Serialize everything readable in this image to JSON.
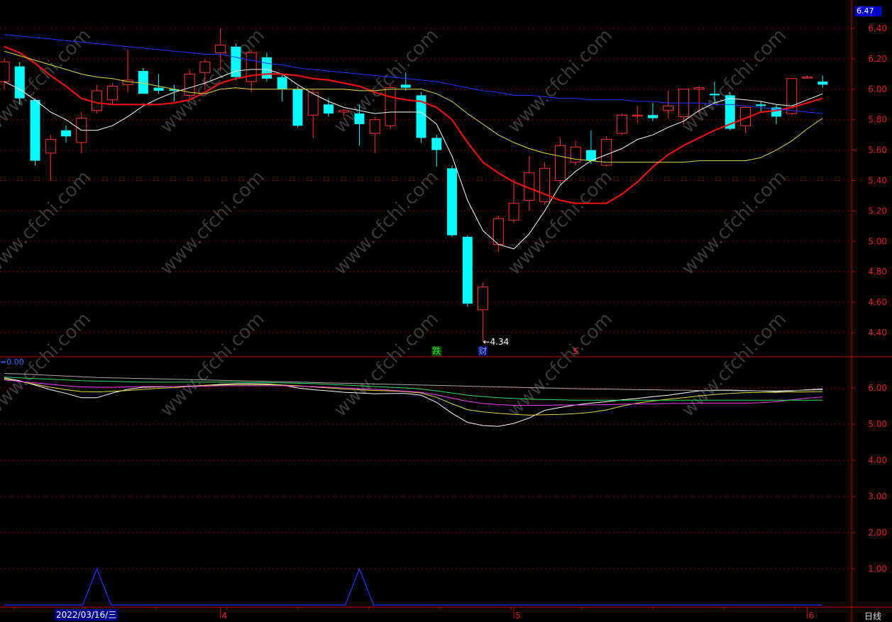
{
  "header": {
    "price_label": "6.47"
  },
  "footer": {
    "date_label": "2022/03/16/三",
    "period_label": "日线"
  },
  "sub_panel": {
    "label": "=0.00"
  },
  "chart_data": [
    {
      "type": "candlestick",
      "panel": "main",
      "y_ticks": [
        "6.40",
        "6.20",
        "6.00",
        "5.80",
        "5.60",
        "5.40",
        "5.20",
        "5.00",
        "4.80",
        "4.60",
        "4.40"
      ],
      "ylim": [
        4.24,
        6.47
      ],
      "x_ticks": [
        {
          "index": 14,
          "label": "4"
        },
        {
          "index": 33,
          "label": "5"
        },
        {
          "index": 52,
          "label": "6"
        }
      ],
      "colors": {
        "up": "#ff3333",
        "down": "#00ffff",
        "grid": "#8a0000",
        "axis": "#cc0000"
      },
      "candles": [
        {
          "o": 6.05,
          "h": 6.2,
          "l": 6.0,
          "c": 6.18
        },
        {
          "o": 6.15,
          "h": 6.18,
          "l": 5.9,
          "c": 5.94
        },
        {
          "o": 5.93,
          "h": 5.94,
          "l": 5.5,
          "c": 5.53
        },
        {
          "o": 5.58,
          "h": 5.7,
          "l": 5.4,
          "c": 5.67
        },
        {
          "o": 5.73,
          "h": 5.76,
          "l": 5.65,
          "c": 5.69
        },
        {
          "o": 5.65,
          "h": 5.85,
          "l": 5.58,
          "c": 5.81
        },
        {
          "o": 5.86,
          "h": 6.03,
          "l": 5.84,
          "c": 5.99
        },
        {
          "o": 5.93,
          "h": 6.04,
          "l": 5.9,
          "c": 6.02
        },
        {
          "o": 6.03,
          "h": 6.26,
          "l": 5.98,
          "c": 6.06
        },
        {
          "o": 6.12,
          "h": 6.14,
          "l": 5.98,
          "c": 5.97
        },
        {
          "o": 6.01,
          "h": 6.1,
          "l": 5.97,
          "c": 5.99
        },
        {
          "o": 6.0,
          "h": 6.03,
          "l": 5.92,
          "c": 5.99
        },
        {
          "o": 5.96,
          "h": 6.13,
          "l": 5.93,
          "c": 6.1
        },
        {
          "o": 6.11,
          "h": 6.2,
          "l": 6.0,
          "c": 6.18
        },
        {
          "o": 6.24,
          "h": 6.4,
          "l": 6.12,
          "c": 6.29
        },
        {
          "o": 6.28,
          "h": 6.3,
          "l": 6.06,
          "c": 6.08
        },
        {
          "o": 6.05,
          "h": 6.26,
          "l": 5.98,
          "c": 6.24
        },
        {
          "o": 6.21,
          "h": 6.24,
          "l": 6.05,
          "c": 6.07
        },
        {
          "o": 6.08,
          "h": 6.1,
          "l": 5.92,
          "c": 6.0
        },
        {
          "o": 6.0,
          "h": 6.02,
          "l": 5.75,
          "c": 5.76
        },
        {
          "o": 5.83,
          "h": 6.0,
          "l": 5.68,
          "c": 5.98
        },
        {
          "o": 5.9,
          "h": 5.94,
          "l": 5.82,
          "c": 5.84
        },
        {
          "o": 5.85,
          "h": 5.87,
          "l": 5.82,
          "c": 5.86
        },
        {
          "o": 5.84,
          "h": 5.9,
          "l": 5.63,
          "c": 5.77
        },
        {
          "o": 5.71,
          "h": 5.82,
          "l": 5.58,
          "c": 5.8
        },
        {
          "o": 5.76,
          "h": 6.03,
          "l": 5.74,
          "c": 6.01
        },
        {
          "o": 6.03,
          "h": 6.11,
          "l": 5.99,
          "c": 6.01
        },
        {
          "o": 5.96,
          "h": 5.98,
          "l": 5.65,
          "c": 5.68
        },
        {
          "o": 5.68,
          "h": 5.7,
          "l": 5.49,
          "c": 5.6
        },
        {
          "o": 5.48,
          "h": 5.5,
          "l": 5.03,
          "c": 5.04
        },
        {
          "o": 5.03,
          "h": 5.04,
          "l": 4.57,
          "c": 4.59
        },
        {
          "o": 4.55,
          "h": 4.73,
          "l": 4.34,
          "c": 4.7
        },
        {
          "o": 4.98,
          "h": 5.17,
          "l": 4.93,
          "c": 5.15
        },
        {
          "o": 5.14,
          "h": 5.41,
          "l": 5.12,
          "c": 5.25
        },
        {
          "o": 5.27,
          "h": 5.56,
          "l": 5.2,
          "c": 5.45
        },
        {
          "o": 5.26,
          "h": 5.52,
          "l": 5.24,
          "c": 5.48
        },
        {
          "o": 5.4,
          "h": 5.68,
          "l": 5.38,
          "c": 5.63
        },
        {
          "o": 5.52,
          "h": 5.66,
          "l": 5.5,
          "c": 5.62
        },
        {
          "o": 5.6,
          "h": 5.73,
          "l": 5.51,
          "c": 5.53
        },
        {
          "o": 5.5,
          "h": 5.69,
          "l": 5.49,
          "c": 5.67
        },
        {
          "o": 5.71,
          "h": 5.84,
          "l": 5.7,
          "c": 5.83
        },
        {
          "o": 5.83,
          "h": 5.89,
          "l": 5.78,
          "c": 5.83
        },
        {
          "o": 5.83,
          "h": 5.91,
          "l": 5.79,
          "c": 5.81
        },
        {
          "o": 5.86,
          "h": 5.99,
          "l": 5.81,
          "c": 5.89
        },
        {
          "o": 5.82,
          "h": 6.0,
          "l": 5.77,
          "c": 6.0
        },
        {
          "o": 6.0,
          "h": 6.02,
          "l": 5.84,
          "c": 6.01
        },
        {
          "o": 5.97,
          "h": 6.05,
          "l": 5.91,
          "c": 5.96
        },
        {
          "o": 5.96,
          "h": 5.98,
          "l": 5.73,
          "c": 5.74
        },
        {
          "o": 5.76,
          "h": 5.89,
          "l": 5.71,
          "c": 5.88
        },
        {
          "o": 5.9,
          "h": 5.92,
          "l": 5.85,
          "c": 5.89
        },
        {
          "o": 5.88,
          "h": 5.9,
          "l": 5.77,
          "c": 5.82
        },
        {
          "o": 5.84,
          "h": 6.07,
          "l": 5.83,
          "c": 6.07
        },
        {
          "o": 6.08,
          "h": 6.09,
          "l": 6.07,
          "c": 6.08
        },
        {
          "o": 6.05,
          "h": 6.09,
          "l": 6.01,
          "c": 6.03
        }
      ],
      "ma_lines": [
        {
          "color": "#ffffff",
          "width": 1,
          "values": [
            6.05,
            6.0,
            5.93,
            5.85,
            5.8,
            5.73,
            5.73,
            5.76,
            5.82,
            5.89,
            5.94,
            5.98,
            6.01,
            6.04,
            6.08,
            6.12,
            6.13,
            6.13,
            6.1,
            6.03,
            5.97,
            5.92,
            5.88,
            5.86,
            5.84,
            5.85,
            5.85,
            5.85,
            5.77,
            5.56,
            5.27,
            5.07,
            4.98,
            4.95,
            5.05,
            5.2,
            5.37,
            5.46,
            5.53,
            5.57,
            5.61,
            5.67,
            5.7,
            5.75,
            5.79,
            5.86,
            5.91,
            5.94,
            5.93,
            5.92,
            5.9,
            5.89,
            5.93,
            5.97
          ]
        },
        {
          "color": "#ee1111",
          "width": 2.2,
          "values": [
            6.28,
            6.24,
            6.17,
            6.09,
            6.02,
            5.94,
            5.91,
            5.9,
            5.9,
            5.9,
            5.9,
            5.91,
            5.93,
            5.98,
            6.04,
            6.07,
            6.09,
            6.1,
            6.1,
            6.09,
            6.07,
            6.06,
            6.04,
            6.02,
            5.98,
            5.95,
            5.93,
            5.92,
            5.88,
            5.8,
            5.65,
            5.52,
            5.45,
            5.39,
            5.35,
            5.31,
            5.27,
            5.25,
            5.25,
            5.25,
            5.31,
            5.39,
            5.49,
            5.57,
            5.63,
            5.68,
            5.73,
            5.77,
            5.81,
            5.85,
            5.86,
            5.88,
            5.91,
            5.94
          ]
        },
        {
          "color": "#dddd44",
          "width": 1,
          "values": [
            6.25,
            6.22,
            6.19,
            6.16,
            6.13,
            6.1,
            6.08,
            6.07,
            6.05,
            6.04,
            6.02,
            6.0,
            5.98,
            5.97,
            6.0,
            6.01,
            6.0,
            6.0,
            6.0,
            6.0,
            6.0,
            6.0,
            6.0,
            5.99,
            5.99,
            6.0,
            6.0,
            6.0,
            5.97,
            5.92,
            5.84,
            5.77,
            5.7,
            5.65,
            5.61,
            5.58,
            5.56,
            5.54,
            5.53,
            5.52,
            5.52,
            5.52,
            5.52,
            5.52,
            5.52,
            5.53,
            5.53,
            5.53,
            5.53,
            5.55,
            5.6,
            5.66,
            5.74,
            5.81
          ]
        },
        {
          "color": "#2233ff",
          "width": 1,
          "values": [
            6.36,
            6.35,
            6.34,
            6.33,
            6.32,
            6.31,
            6.3,
            6.29,
            6.28,
            6.27,
            6.26,
            6.25,
            6.24,
            6.23,
            6.23,
            6.21,
            6.19,
            6.17,
            6.16,
            6.14,
            6.13,
            6.12,
            6.11,
            6.1,
            6.09,
            6.08,
            6.07,
            6.06,
            6.05,
            6.03,
            6.01,
            5.99,
            5.98,
            5.96,
            5.96,
            5.95,
            5.94,
            5.94,
            5.93,
            5.93,
            5.93,
            5.92,
            5.92,
            5.91,
            5.91,
            5.91,
            5.9,
            5.9,
            5.89,
            5.88,
            5.87,
            5.86,
            5.85,
            5.84
          ]
        }
      ],
      "annotations": [
        {
          "index": 31,
          "value": 4.34,
          "text": "←4.34",
          "color": "#ffffff"
        },
        {
          "index": 28,
          "text": "跌",
          "color": "#33dd33",
          "bg": "#004400"
        },
        {
          "index": 31,
          "text": "财",
          "color": "#66aaff",
          "bg": "#000066"
        },
        {
          "index": 37,
          "text": "$",
          "color": "#ff3333"
        }
      ]
    },
    {
      "type": "line",
      "panel": "sub",
      "y_ticks": [
        "6.00",
        "5.00",
        "4.00",
        "3.00",
        "2.00",
        "1.00"
      ],
      "ylim": [
        0,
        6.8
      ],
      "series": [
        {
          "color": "#ffffff",
          "values": [
            6.28,
            6.2,
            6.08,
            5.95,
            5.85,
            5.73,
            5.73,
            5.86,
            5.96,
            6.02,
            6.03,
            6.04,
            6.05,
            6.07,
            6.1,
            6.12,
            6.12,
            6.11,
            6.08,
            6.0,
            5.95,
            5.92,
            5.88,
            5.86,
            5.84,
            5.85,
            5.85,
            5.8,
            5.6,
            5.3,
            5.05,
            4.96,
            4.94,
            5.02,
            5.17,
            5.38,
            5.46,
            5.53,
            5.58,
            5.62,
            5.67,
            5.71,
            5.76,
            5.8,
            5.86,
            5.92,
            5.94,
            5.94,
            5.93,
            5.92,
            5.9,
            5.92,
            5.95,
            5.97
          ]
        },
        {
          "color": "#dddd44",
          "values": [
            6.25,
            6.18,
            6.1,
            6.02,
            5.95,
            5.9,
            5.89,
            5.91,
            5.93,
            5.96,
            5.99,
            6.01,
            6.04,
            6.07,
            6.08,
            6.09,
            6.09,
            6.09,
            6.08,
            6.06,
            6.03,
            6.0,
            5.97,
            5.95,
            5.93,
            5.92,
            5.9,
            5.86,
            5.74,
            5.56,
            5.4,
            5.34,
            5.3,
            5.27,
            5.25,
            5.26,
            5.27,
            5.29,
            5.33,
            5.39,
            5.5,
            5.58,
            5.64,
            5.69,
            5.73,
            5.78,
            5.82,
            5.85,
            5.87,
            5.88,
            5.88,
            5.89,
            5.89,
            5.9
          ]
        },
        {
          "color": "#ee44ee",
          "values": [
            6.22,
            6.18,
            6.14,
            6.1,
            6.06,
            6.03,
            6.02,
            6.02,
            6.03,
            6.04,
            6.04,
            6.04,
            6.04,
            6.05,
            6.06,
            6.06,
            6.06,
            6.06,
            6.06,
            6.05,
            6.04,
            6.02,
            6.0,
            5.98,
            5.96,
            5.94,
            5.91,
            5.88,
            5.81,
            5.72,
            5.63,
            5.57,
            5.54,
            5.52,
            5.52,
            5.52,
            5.53,
            5.53,
            5.53,
            5.54,
            5.55,
            5.56,
            5.56,
            5.57,
            5.57,
            5.58,
            5.58,
            5.58,
            5.58,
            5.59,
            5.62,
            5.67,
            5.72,
            5.75
          ]
        },
        {
          "color": "#33dd66",
          "values": [
            6.3,
            6.28,
            6.26,
            6.24,
            6.22,
            6.2,
            6.19,
            6.18,
            6.17,
            6.16,
            6.16,
            6.16,
            6.16,
            6.16,
            6.16,
            6.16,
            6.15,
            6.15,
            6.14,
            6.13,
            6.12,
            6.1,
            6.08,
            6.06,
            6.04,
            6.02,
            6.0,
            5.97,
            5.92,
            5.86,
            5.8,
            5.76,
            5.73,
            5.71,
            5.69,
            5.68,
            5.67,
            5.66,
            5.66,
            5.66,
            5.66,
            5.66,
            5.66,
            5.66,
            5.66,
            5.66,
            5.66,
            5.66,
            5.66,
            5.66,
            5.66,
            5.66,
            5.66,
            5.66
          ]
        },
        {
          "color": "#aaaaaa",
          "values": [
            6.4,
            6.39,
            6.37,
            6.35,
            6.33,
            6.31,
            6.29,
            6.28,
            6.27,
            6.26,
            6.25,
            6.24,
            6.23,
            6.22,
            6.21,
            6.2,
            6.19,
            6.18,
            6.17,
            6.16,
            6.15,
            6.14,
            6.13,
            6.12,
            6.11,
            6.1,
            6.09,
            6.08,
            6.07,
            6.06,
            6.05,
            6.04,
            6.03,
            6.02,
            6.01,
            6.0,
            5.99,
            5.98,
            5.97,
            5.97,
            5.96,
            5.95,
            5.95,
            5.94,
            5.94,
            5.93,
            5.93,
            5.93,
            5.92,
            5.92,
            5.92,
            5.93,
            5.94,
            5.95
          ]
        }
      ],
      "signal": {
        "color": "#2233ff",
        "values": [
          0,
          0,
          0,
          0,
          0,
          0,
          1,
          0,
          0,
          0,
          0,
          0,
          0,
          0,
          0,
          0,
          0,
          0,
          0,
          0,
          0,
          0,
          0,
          1,
          0,
          0,
          0,
          0,
          0,
          0,
          0,
          0,
          0,
          0,
          0,
          0,
          0,
          0,
          0,
          0,
          0,
          0,
          0,
          0,
          0,
          0,
          0,
          0,
          0,
          0,
          0,
          0,
          0,
          0
        ]
      }
    }
  ]
}
